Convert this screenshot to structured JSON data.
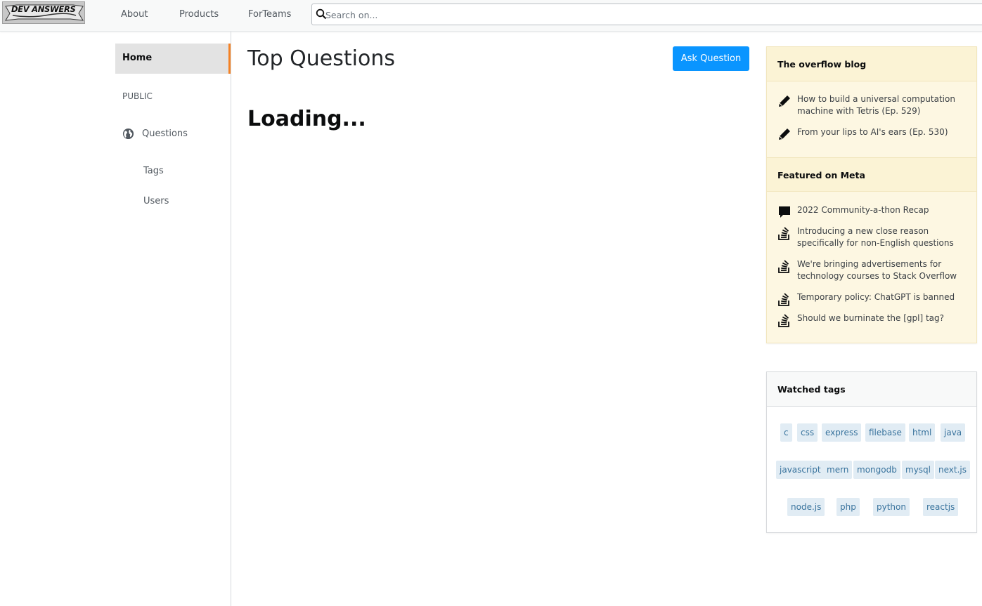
{
  "topbar": {
    "logo_text": "DEV ANSWERS",
    "nav": [
      "About",
      "Products",
      "ForTeams"
    ],
    "search_placeholder": "Search on..."
  },
  "sidebar": {
    "home": "Home",
    "section": "PUBLIC",
    "questions": "Questions",
    "tags": "Tags",
    "users": "Users"
  },
  "main": {
    "title": "Top Questions",
    "ask_button": "Ask Question",
    "loading": "Loading..."
  },
  "overflow_blog": {
    "heading": "The overflow blog",
    "items": [
      "How to build a universal computation machine with Tetris (Ep. 529)",
      "From your lips to AI's ears (Ep. 530)"
    ]
  },
  "featured_meta": {
    "heading": "Featured on Meta",
    "items": [
      {
        "icon": "comment-icon",
        "text": "2022 Community-a-thon Recap"
      },
      {
        "icon": "stack-icon",
        "text": "Introducing a new close reason specifically for non-English questions"
      },
      {
        "icon": "stack-icon",
        "text": "We're bringing advertisements for technology courses to Stack Overflow"
      },
      {
        "icon": "stack-icon",
        "text": "Temporary policy: ChatGPT is banned"
      },
      {
        "icon": "stack-icon",
        "text": "Should we burninate the [gpl] tag?"
      }
    ]
  },
  "watched_tags": {
    "heading": "Watched tags",
    "tags": [
      "c",
      "css",
      "express",
      "filebase",
      "html",
      "java",
      "javascript",
      "mern",
      "mongodb",
      "mysql",
      "next.js",
      "node.js",
      "php",
      "python",
      "reactjs"
    ]
  },
  "colors": {
    "accent": "#f48225",
    "button": "#0a95ff",
    "widget_bg": "#fdf7e2",
    "tag_bg": "#e1ecf4",
    "tag_text": "#39739d"
  }
}
